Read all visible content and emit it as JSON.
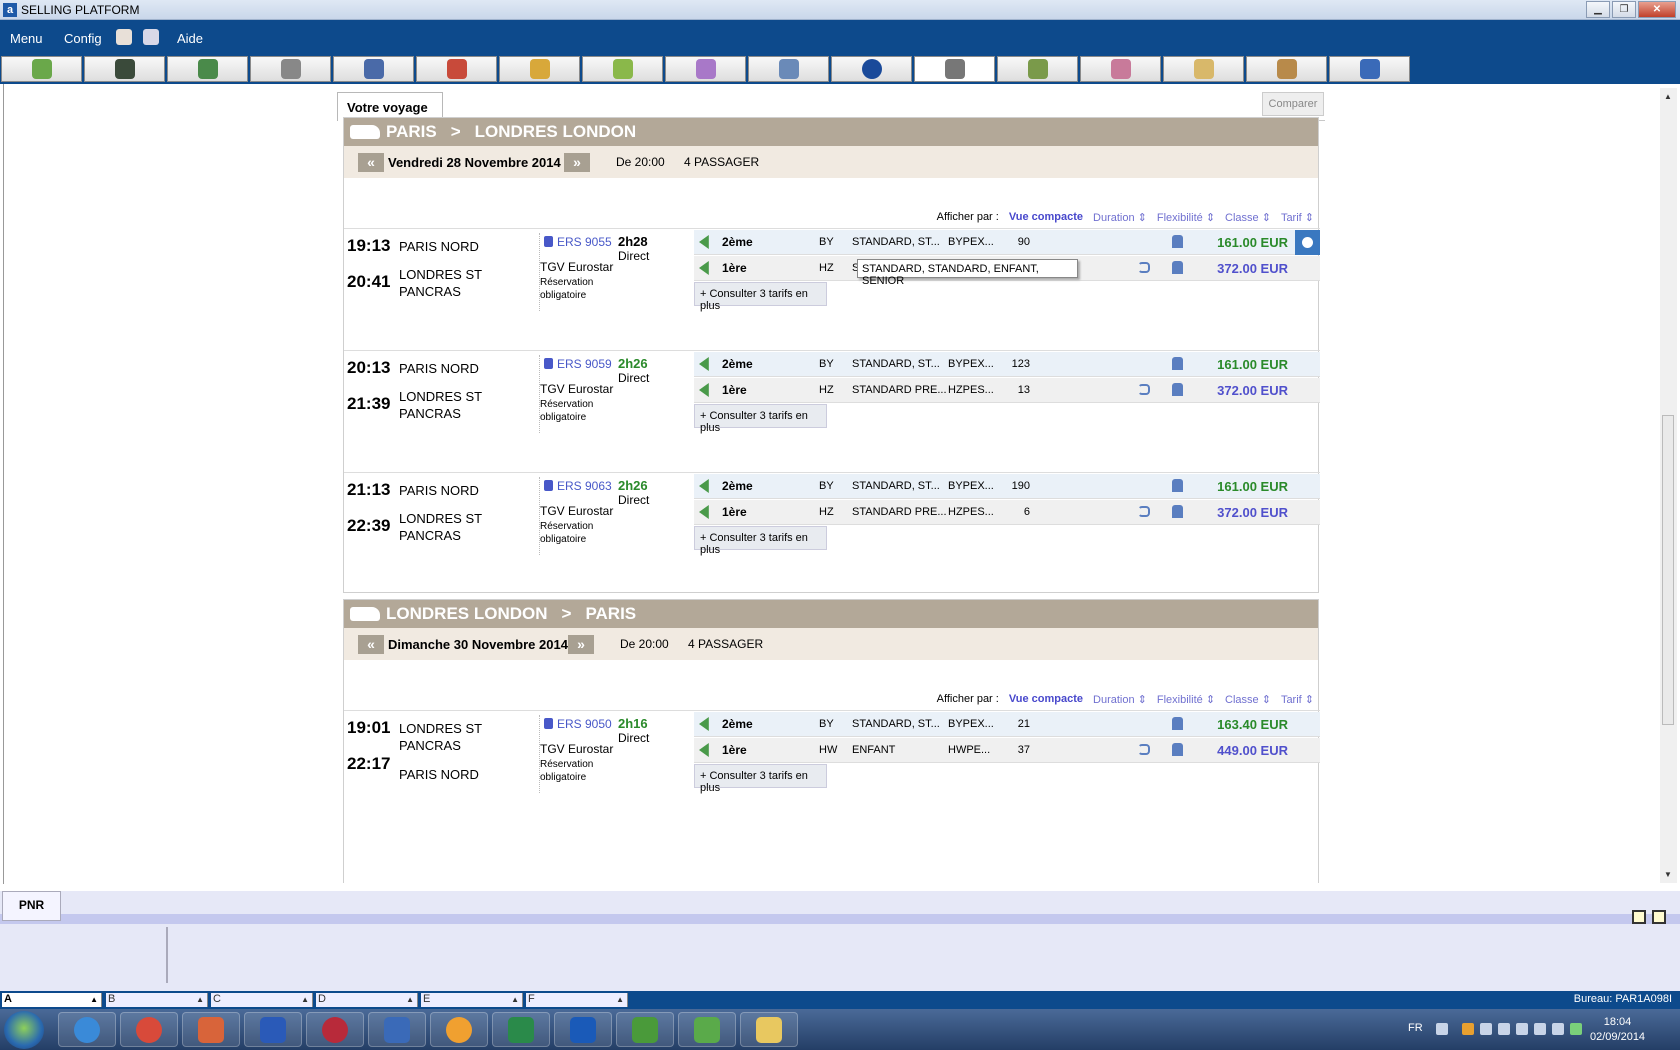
{
  "window": {
    "title": "SELLING PLATFORM",
    "app_icon": "a"
  },
  "menu": {
    "items": [
      "Menu",
      "Config",
      "Aide"
    ]
  },
  "panel": {
    "tab_label": "Votre voyage",
    "compare_label": "Comparer"
  },
  "sort_bar": {
    "label": "Afficher par :",
    "compact": "Vue compacte",
    "duration": "Duration",
    "flex": "Flexibilité",
    "classe": "Classe",
    "tarif": "Tarif"
  },
  "sort_arrow": "⇕",
  "consult_label": "+ Consulter 3 tarifs en plus",
  "tooltip": "STANDARD, STANDARD, ENFANT, SENIOR",
  "nav": {
    "prev": "«",
    "next": "»"
  },
  "routes": [
    {
      "from": "PARIS",
      "sep": ">",
      "to": "LONDRES LONDON",
      "date": "Vendredi 28 Novembre 2014",
      "time_from": "De 20:00",
      "passengers": "4 PASSAGER",
      "trains": [
        {
          "dep": "19:13",
          "dep_station": "PARIS NORD",
          "arr": "20:41",
          "arr_station": "LONDRES ST PANCRAS",
          "number": "ERS 9055",
          "duration": "2h28",
          "duration_color": "#000000",
          "type": "Direct",
          "operator": "TGV Eurostar",
          "reservation": "Réservation obligatoire",
          "fares": [
            {
              "cls": "2ème",
              "code": "BY",
              "desc": "STANDARD, ST...",
              "fare_code": "BYPEX...",
              "seats": "90",
              "flex": false,
              "price": "161.00 EUR",
              "price_color": "green",
              "selected": true
            },
            {
              "cls": "1ère",
              "code": "HZ",
              "desc": "STANDARD PRE...",
              "fare_code": "HZPES...",
              "seats": "",
              "flex": true,
              "price": "372.00 EUR",
              "price_color": "blue",
              "selected": false
            }
          ]
        },
        {
          "dep": "20:13",
          "dep_station": "PARIS NORD",
          "arr": "21:39",
          "arr_station": "LONDRES ST PANCRAS",
          "number": "ERS 9059",
          "duration": "2h26",
          "duration_color": "#2a8a2a",
          "type": "Direct",
          "operator": "TGV Eurostar",
          "reservation": "Réservation obligatoire",
          "fares": [
            {
              "cls": "2ème",
              "code": "BY",
              "desc": "STANDARD, ST...",
              "fare_code": "BYPEX...",
              "seats": "123",
              "flex": false,
              "price": "161.00 EUR",
              "price_color": "green",
              "selected": false
            },
            {
              "cls": "1ère",
              "code": "HZ",
              "desc": "STANDARD PRE...",
              "fare_code": "HZPES...",
              "seats": "13",
              "flex": true,
              "price": "372.00 EUR",
              "price_color": "blue",
              "selected": false
            }
          ]
        },
        {
          "dep": "21:13",
          "dep_station": "PARIS NORD",
          "arr": "22:39",
          "arr_station": "LONDRES ST PANCRAS",
          "number": "ERS 9063",
          "duration": "2h26",
          "duration_color": "#2a8a2a",
          "type": "Direct",
          "operator": "TGV Eurostar",
          "reservation": "Réservation obligatoire",
          "fares": [
            {
              "cls": "2ème",
              "code": "BY",
              "desc": "STANDARD, ST...",
              "fare_code": "BYPEX...",
              "seats": "190",
              "flex": false,
              "price": "161.00 EUR",
              "price_color": "green",
              "selected": false
            },
            {
              "cls": "1ère",
              "code": "HZ",
              "desc": "STANDARD PRE...",
              "fare_code": "HZPES...",
              "seats": "6",
              "flex": true,
              "price": "372.00 EUR",
              "price_color": "blue",
              "selected": false
            }
          ]
        }
      ]
    },
    {
      "from": "LONDRES LONDON",
      "sep": ">",
      "to": "PARIS",
      "date": "Dimanche 30 Novembre 2014",
      "time_from": "De 20:00",
      "passengers": "4 PASSAGER",
      "trains": [
        {
          "dep": "19:01",
          "dep_station": "LONDRES ST PANCRAS",
          "arr": "22:17",
          "arr_station": "PARIS NORD",
          "number": "ERS 9050",
          "duration": "2h16",
          "duration_color": "#2a8a2a",
          "type": "Direct",
          "operator": "TGV Eurostar",
          "reservation": "Réservation obligatoire",
          "fares": [
            {
              "cls": "2ème",
              "code": "BY",
              "desc": "STANDARD, ST...",
              "fare_code": "BYPEX...",
              "seats": "21",
              "flex": false,
              "price": "163.40 EUR",
              "price_color": "green",
              "selected": false
            },
            {
              "cls": "1ère",
              "code": "HW",
              "desc": "ENFANT",
              "fare_code": "HWPE...",
              "seats": "37",
              "flex": true,
              "price": "449.00 EUR",
              "price_color": "blue",
              "selected": false
            }
          ]
        }
      ]
    }
  ],
  "pnr": {
    "tab": "PNR"
  },
  "slots": [
    "A",
    "B",
    "C",
    "D",
    "E",
    "F"
  ],
  "bureau": "Bureau: PAR1A098I",
  "tray": {
    "lang": "FR",
    "time": "18:04",
    "date": "02/09/2014"
  },
  "colors": {
    "menubar": "#0d4a8c",
    "route_header": "#b3a898",
    "price_green": "#2a8a2a",
    "price_blue": "#5050cc"
  }
}
